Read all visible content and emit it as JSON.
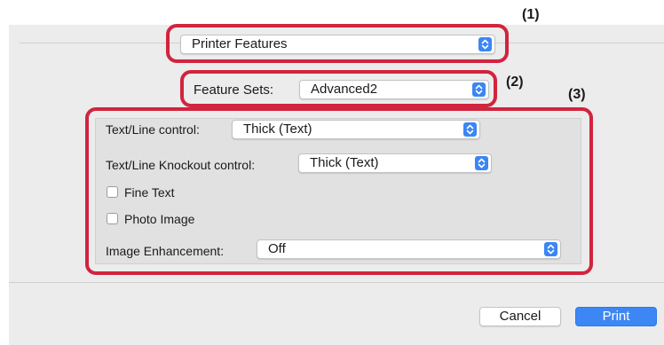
{
  "callouts": [
    "(1)",
    "(2)",
    "(3)"
  ],
  "panel_popup": {
    "value": "Printer Features"
  },
  "feature_sets": {
    "label": "Feature Sets:",
    "value": "Advanced2"
  },
  "text_line_control": {
    "label": "Text/Line control:",
    "value": "Thick (Text)"
  },
  "knockout_control": {
    "label": "Text/Line Knockout control:",
    "value": "Thick (Text)"
  },
  "fine_text": {
    "label": "Fine Text",
    "checked": false
  },
  "photo_image": {
    "label": "Photo Image",
    "checked": false
  },
  "image_enhancement": {
    "label": "Image Enhancement:",
    "value": "Off"
  },
  "buttons": {
    "cancel": "Cancel",
    "print": "Print"
  },
  "colors": {
    "accent": "#3b86f5",
    "callout": "#d1243e"
  }
}
